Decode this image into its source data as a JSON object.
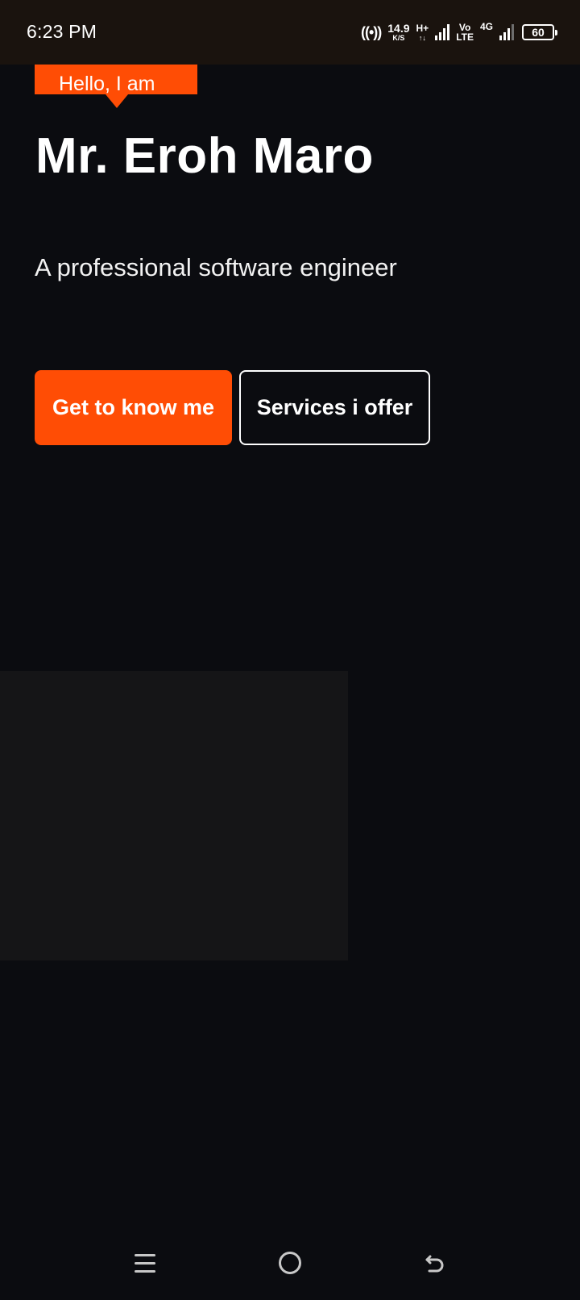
{
  "status_bar": {
    "time": "6:23 PM",
    "net_speed_value": "14.9",
    "net_speed_unit": "K/S",
    "network_type_1": "H+",
    "volte_top": "Vo",
    "volte_bottom": "LTE",
    "network_type_2": "4G",
    "battery_level": "60",
    "icons": [
      "hotspot-icon",
      "signal-icon",
      "signal-icon",
      "battery-icon"
    ]
  },
  "hero": {
    "greeting": "Hello, I am",
    "name": "Mr. Eroh Maro",
    "subtitle": "A professional software engineer",
    "primary_button": "Get to know me",
    "secondary_button": "Services i offer"
  },
  "colors": {
    "accent": "#ff4d05",
    "background": "#0b0c10",
    "status_bar_bg": "#1a130e",
    "panel": "#151517"
  },
  "nav_bar": {
    "icons": [
      "recent-apps-icon",
      "home-icon",
      "back-icon"
    ]
  }
}
